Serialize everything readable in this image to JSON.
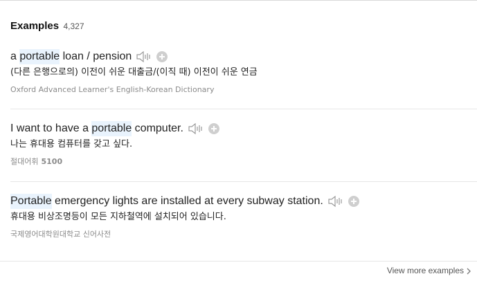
{
  "header": {
    "title": "Examples",
    "count": "4,327"
  },
  "examples": [
    {
      "segments": [
        "a ",
        "portable",
        " loan / pension"
      ],
      "translation": "(다른 은행으로의) 이전이 쉬운 대출금/(이직 때) 이전이 쉬운 연금",
      "source": "Oxford Advanced Learner's English-Korean Dictionary",
      "source_num": ""
    },
    {
      "segments": [
        "I want to have a ",
        "portable",
        " computer."
      ],
      "translation": "나는 휴대용 컴퓨터를 갖고 싶다.",
      "source": "절대어휘",
      "source_num": "5100"
    },
    {
      "segments": [
        "",
        "Portable",
        " emergency lights are installed at every subway station."
      ],
      "translation": "휴대용 비상조명등이 모든 지하철역에 설치되어 있습니다.",
      "source": "국제영어대학원대학교 신어사전",
      "source_num": ""
    }
  ],
  "icons": {
    "speaker": "speaker-icon",
    "add": "plus-circle-icon",
    "chevron": "chevron-right-icon"
  },
  "colors": {
    "highlight": "#e9f3fd",
    "icon_gray": "#cfcfcf",
    "source_gray": "#8a8a8a"
  },
  "footer": {
    "view_more_label": "View more examples"
  }
}
